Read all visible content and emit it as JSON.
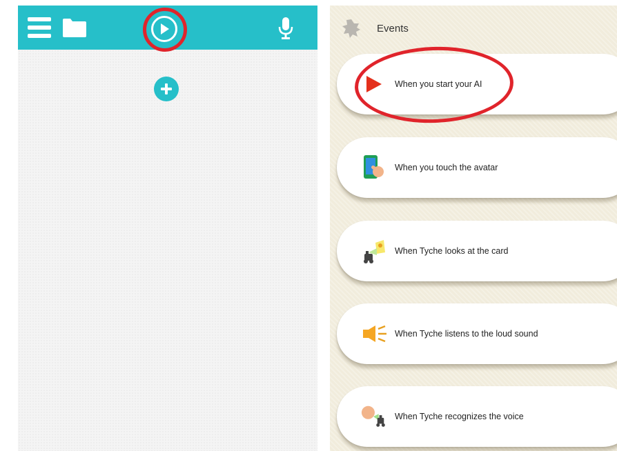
{
  "editor": {
    "toolbar": {
      "menu_icon": "hamburger-menu-icon",
      "folder_icon": "folder-icon",
      "play_icon": "play-circle-icon",
      "mic_icon": "microphone-icon",
      "background_color": "#26bfc9"
    },
    "add_icon": "plus-circle-icon"
  },
  "events_panel": {
    "title": "Events",
    "header_icon": "puzzle-piece-icon",
    "items": [
      {
        "label": "When you start your AI",
        "icon": "red-play-triangle-icon"
      },
      {
        "label": "When you touch the avatar",
        "icon": "phone-touch-icon"
      },
      {
        "label": "When Tyche looks at the card",
        "icon": "robot-card-icon"
      },
      {
        "label": "When Tyche listens to the loud sound",
        "icon": "loudspeaker-icon"
      },
      {
        "label": "When Tyche recognizes the voice",
        "icon": "face-voice-robot-icon"
      }
    ]
  },
  "highlight_color": "#e0242b"
}
